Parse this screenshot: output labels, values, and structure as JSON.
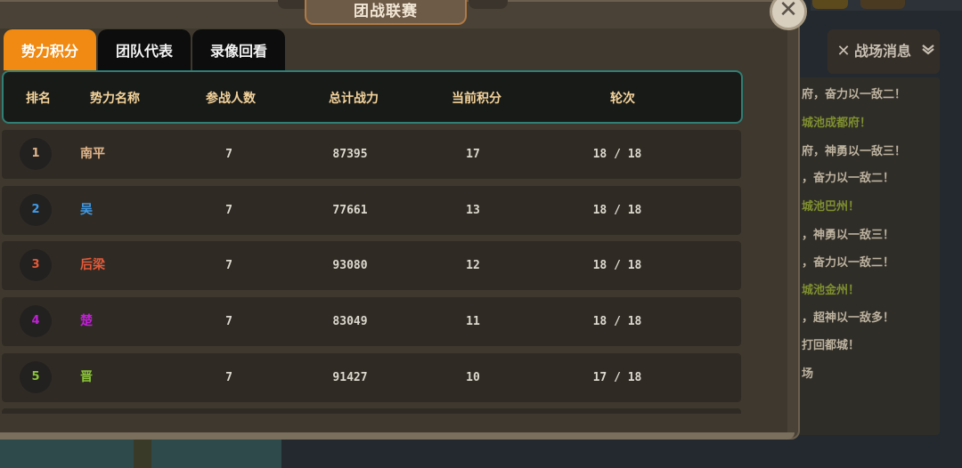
{
  "title": "团战联赛",
  "close_icon": "close-icon",
  "tabs": [
    {
      "label": "势力积分",
      "active": true
    },
    {
      "label": "团队代表",
      "active": false
    },
    {
      "label": "录像回看",
      "active": false
    }
  ],
  "table": {
    "headers": [
      "排名",
      "势力名称",
      "参战人数",
      "总计战力",
      "当前积分",
      "轮次"
    ],
    "rows": [
      {
        "rank": "1",
        "name": "南平",
        "players": "7",
        "power": "87395",
        "score": "17",
        "round": "18 / 18",
        "color": "#e0b48a"
      },
      {
        "rank": "2",
        "name": "吴",
        "players": "7",
        "power": "77661",
        "score": "13",
        "round": "18 / 18",
        "color": "#3f9be8"
      },
      {
        "rank": "3",
        "name": "后梁",
        "players": "7",
        "power": "93080",
        "score": "12",
        "round": "18 / 18",
        "color": "#e25a3a"
      },
      {
        "rank": "4",
        "name": "楚",
        "players": "7",
        "power": "83049",
        "score": "11",
        "round": "18 / 18",
        "color": "#c21fd8"
      },
      {
        "rank": "5",
        "name": "晋",
        "players": "7",
        "power": "91427",
        "score": "10",
        "round": "17 / 18",
        "color": "#8bc43a"
      }
    ]
  },
  "news": {
    "title": "战场消息",
    "icon": "crossed-swords-icon",
    "chevron": "chevron-down-icon",
    "items": [
      {
        "text": "府，奋力以一敌二！",
        "color": "#bdb29f"
      },
      {
        "text": "城池成都府！",
        "color": "#7f8f2f"
      },
      {
        "text": "府，神勇以一敌三！",
        "color": "#bdb29f"
      },
      {
        "text": "，奋力以一敌二！",
        "color": "#bdb29f"
      },
      {
        "text": "城池巴州！",
        "color": "#7f8f2f"
      },
      {
        "text": "，神勇以一敌三！",
        "color": "#bdb29f"
      },
      {
        "text": "，奋力以一敌二！",
        "color": "#bdb29f"
      },
      {
        "text": "城池金州！",
        "color": "#7f8f2f"
      },
      {
        "text": "，超神以一敌多！",
        "color": "#bdb29f"
      },
      {
        "text": "打回都城！",
        "color": "#bdb29f"
      },
      {
        "text": "场",
        "color": "#bdb29f"
      }
    ]
  }
}
